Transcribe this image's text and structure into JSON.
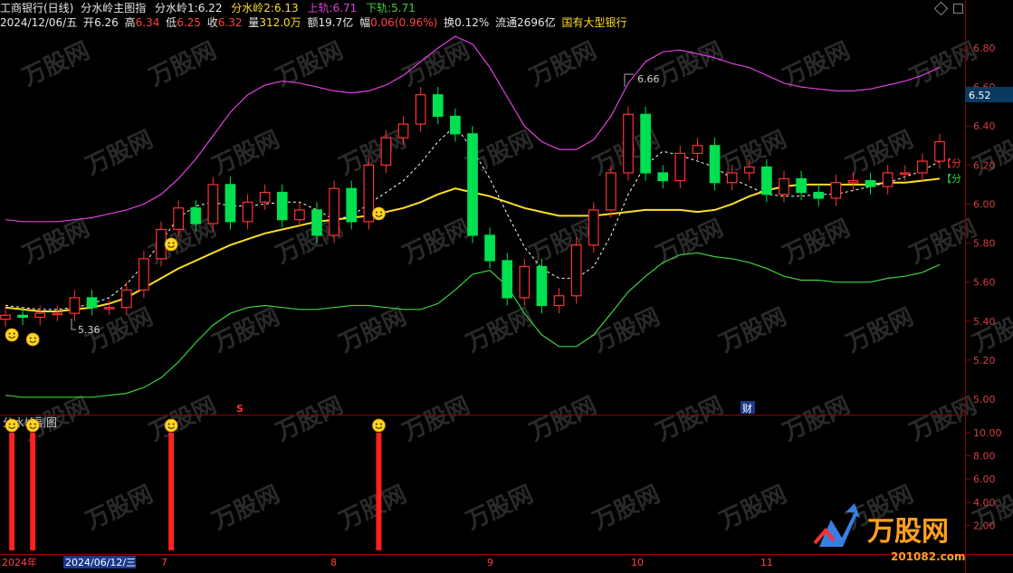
{
  "header": {
    "stock_name": "工商银行(日线)",
    "indicator_title": "分水岭主图指",
    "fsl1_label": "分水岭1:",
    "fsl1_value": "6.22",
    "fsl2_label": "分水岭2:",
    "fsl2_value": "6.13",
    "upper_label": "上轨:",
    "upper_value": "6.71",
    "lower_label": "下轨:",
    "lower_value": "5.71"
  },
  "quote": {
    "date": "2024/12/06/五",
    "open_label": "开",
    "open": "6.26",
    "high_label": "高",
    "high": "6.34",
    "low_label": "低",
    "low": "6.25",
    "close_label": "收",
    "close": "6.32",
    "volume_label": "量",
    "volume": "312.0万",
    "amount_label": "额",
    "amount": "19.7亿",
    "change_label": "幅",
    "change": "0.06(0.96%)",
    "turnover_label": "换",
    "turnover": "0.12%",
    "float_label": "流通",
    "float": "2696亿",
    "sector": "国有大型银行"
  },
  "main_axis": {
    "ticks": [
      "6.80",
      "6.60",
      "6.40",
      "6.20",
      "6.00",
      "5.80",
      "5.60",
      "5.40",
      "5.20",
      "5.00"
    ],
    "current_price": "6.52"
  },
  "annotations": {
    "high_marker": "6.66",
    "low_marker": "5.36",
    "right_label_1": "【分",
    "right_label_2": "【分"
  },
  "event_markers": {
    "s_marker": "S",
    "cai_marker": "财"
  },
  "sub_panel": {
    "title": "分水岭副图",
    "ticks": [
      "10.00",
      "8.00",
      "6.00",
      "4.00",
      "2.00"
    ]
  },
  "x_axis": {
    "year_label": "2024年",
    "cursor_date": "2024/06/12/三",
    "months": [
      "7",
      "8",
      "9",
      "10",
      "11"
    ]
  },
  "watermark": {
    "brand": "万股网",
    "domain": "201082.com"
  },
  "colors": {
    "up_candle": "#ff3232",
    "down_candle": "#00e050",
    "upper_band": "#e040e0",
    "lower_band": "#40d040",
    "middle_line": "#ffdd22",
    "dashed_line": "#ffffff",
    "axis_grid": "#8b0000",
    "signal_bar": "#ff2020"
  },
  "chart_data": [
    {
      "type": "candlestick",
      "title": "分水岭主图指",
      "ylim": [
        4.95,
        6.88
      ],
      "y_ticks": [
        5.0,
        5.2,
        5.4,
        5.6,
        5.8,
        6.0,
        6.2,
        6.4,
        6.6,
        6.8
      ],
      "series": [
        {
          "name": "上轨",
          "values": [
            5.92,
            5.91,
            5.91,
            5.91,
            5.92,
            5.93,
            5.95,
            5.97,
            6.0,
            6.05,
            6.13,
            6.23,
            6.35,
            6.47,
            6.56,
            6.61,
            6.63,
            6.62,
            6.6,
            6.58,
            6.57,
            6.58,
            6.61,
            6.66,
            6.73,
            6.8,
            6.86,
            6.82,
            6.7,
            6.55,
            6.4,
            6.32,
            6.28,
            6.28,
            6.33,
            6.45,
            6.62,
            6.73,
            6.78,
            6.79,
            6.77,
            6.75,
            6.72,
            6.7,
            6.66,
            6.62,
            6.6,
            6.59,
            6.58,
            6.58,
            6.59,
            6.61,
            6.63,
            6.66,
            6.7
          ]
        },
        {
          "name": "下轨",
          "values": [
            5.02,
            5.01,
            5.01,
            5.01,
            5.01,
            5.01,
            5.02,
            5.03,
            5.06,
            5.11,
            5.19,
            5.29,
            5.38,
            5.44,
            5.47,
            5.48,
            5.47,
            5.46,
            5.46,
            5.47,
            5.48,
            5.48,
            5.47,
            5.46,
            5.46,
            5.49,
            5.56,
            5.64,
            5.66,
            5.58,
            5.44,
            5.33,
            5.27,
            5.27,
            5.33,
            5.44,
            5.55,
            5.63,
            5.7,
            5.74,
            5.75,
            5.73,
            5.72,
            5.7,
            5.67,
            5.63,
            5.61,
            5.61,
            5.6,
            5.6,
            5.6,
            5.62,
            5.63,
            5.65,
            5.69
          ]
        },
        {
          "name": "分水岭1",
          "values": [
            5.48,
            5.47,
            5.46,
            5.46,
            5.47,
            5.49,
            5.52,
            5.59,
            5.69,
            5.81,
            5.93,
            5.99,
            6.01,
            5.99,
            5.99,
            6.0,
            6.01,
            6.01,
            5.97,
            5.92,
            5.94,
            6.0,
            6.06,
            6.12,
            6.21,
            6.32,
            6.4,
            6.28,
            6.13,
            5.95,
            5.78,
            5.67,
            5.62,
            5.62,
            5.68,
            5.84,
            6.05,
            6.2,
            6.27,
            6.25,
            6.22,
            6.19,
            6.13,
            6.09,
            6.05,
            6.04,
            6.04,
            6.05,
            6.05,
            6.07,
            6.09,
            6.11,
            6.14,
            6.17,
            6.22
          ]
        },
        {
          "name": "分水岭2",
          "values": [
            5.47,
            5.46,
            5.45,
            5.45,
            5.46,
            5.47,
            5.49,
            5.52,
            5.57,
            5.62,
            5.67,
            5.71,
            5.75,
            5.79,
            5.82,
            5.85,
            5.87,
            5.89,
            5.91,
            5.92,
            5.93,
            5.94,
            5.96,
            5.98,
            6.01,
            6.05,
            6.08,
            6.06,
            6.04,
            6.01,
            5.98,
            5.96,
            5.94,
            5.94,
            5.94,
            5.95,
            5.96,
            5.97,
            5.97,
            5.97,
            5.96,
            5.97,
            6.0,
            6.04,
            6.07,
            6.09,
            6.1,
            6.1,
            6.1,
            6.1,
            6.1,
            6.11,
            6.11,
            6.12,
            6.13
          ]
        },
        {
          "name": "close",
          "values": [
            5.43,
            5.42,
            5.44,
            5.44,
            5.52,
            5.47,
            5.47,
            5.56,
            5.72,
            5.87,
            5.98,
            5.9,
            6.1,
            5.91,
            6.01,
            6.06,
            5.92,
            5.97,
            5.84,
            6.08,
            5.91,
            6.2,
            6.34,
            6.41,
            6.56,
            6.45,
            6.36,
            5.84,
            5.71,
            5.52,
            5.68,
            5.48,
            5.53,
            5.79,
            5.97,
            6.16,
            6.46,
            6.16,
            6.12,
            6.26,
            6.3,
            6.11,
            6.16,
            6.19,
            6.05,
            6.13,
            6.06,
            6.03,
            6.11,
            6.12,
            6.09,
            6.16,
            6.16,
            6.22,
            6.32
          ]
        }
      ]
    },
    {
      "type": "bar",
      "title": "分水岭副图",
      "ylim": [
        0,
        11
      ],
      "y_ticks": [
        2,
        4,
        6,
        8,
        10
      ],
      "series": [
        {
          "name": "信号",
          "bars": [
            {
              "x": 1,
              "value": 10
            },
            {
              "x": 2,
              "value": 10
            },
            {
              "x": 10,
              "value": 10
            },
            {
              "x": 22,
              "value": 10
            }
          ]
        }
      ]
    }
  ]
}
